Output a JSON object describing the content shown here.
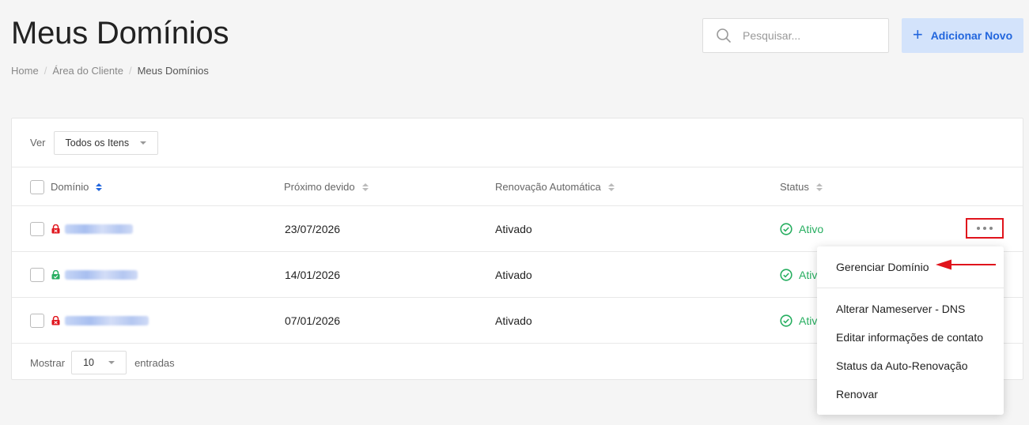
{
  "header": {
    "title": "Meus Domínios",
    "breadcrumb": [
      "Home",
      "Área do Cliente",
      "Meus Domínios"
    ],
    "search_placeholder": "Pesquisar...",
    "add_button": "Adicionar Novo",
    "add_plus": "+"
  },
  "filter": {
    "label": "Ver",
    "selected": "Todos os Itens"
  },
  "table": {
    "columns": [
      "Domínio",
      "Próximo devido",
      "Renovação Automática",
      "Status"
    ],
    "rows": [
      {
        "lock": "locked-red",
        "due": "23/07/2026",
        "auto_renew": "Ativado",
        "status": "Ativo"
      },
      {
        "lock": "unlocked-green",
        "due": "14/01/2026",
        "auto_renew": "Ativado",
        "status": "Ativo"
      },
      {
        "lock": "locked-red",
        "due": "07/01/2026",
        "auto_renew": "Ativado",
        "status": "Ativo"
      }
    ]
  },
  "footer": {
    "show_label": "Mostrar",
    "page_size": "10",
    "entries_label": "entradas"
  },
  "dropdown": {
    "items": [
      "Gerenciar Domínio",
      "Alterar Nameserver - DNS",
      "Editar informações de contato",
      "Status da Auto-Renovação",
      "Renovar"
    ]
  },
  "colors": {
    "accent": "#2266dd",
    "active": "#27ae60",
    "locked": "#e0141c",
    "highlight": "#e0141c"
  }
}
